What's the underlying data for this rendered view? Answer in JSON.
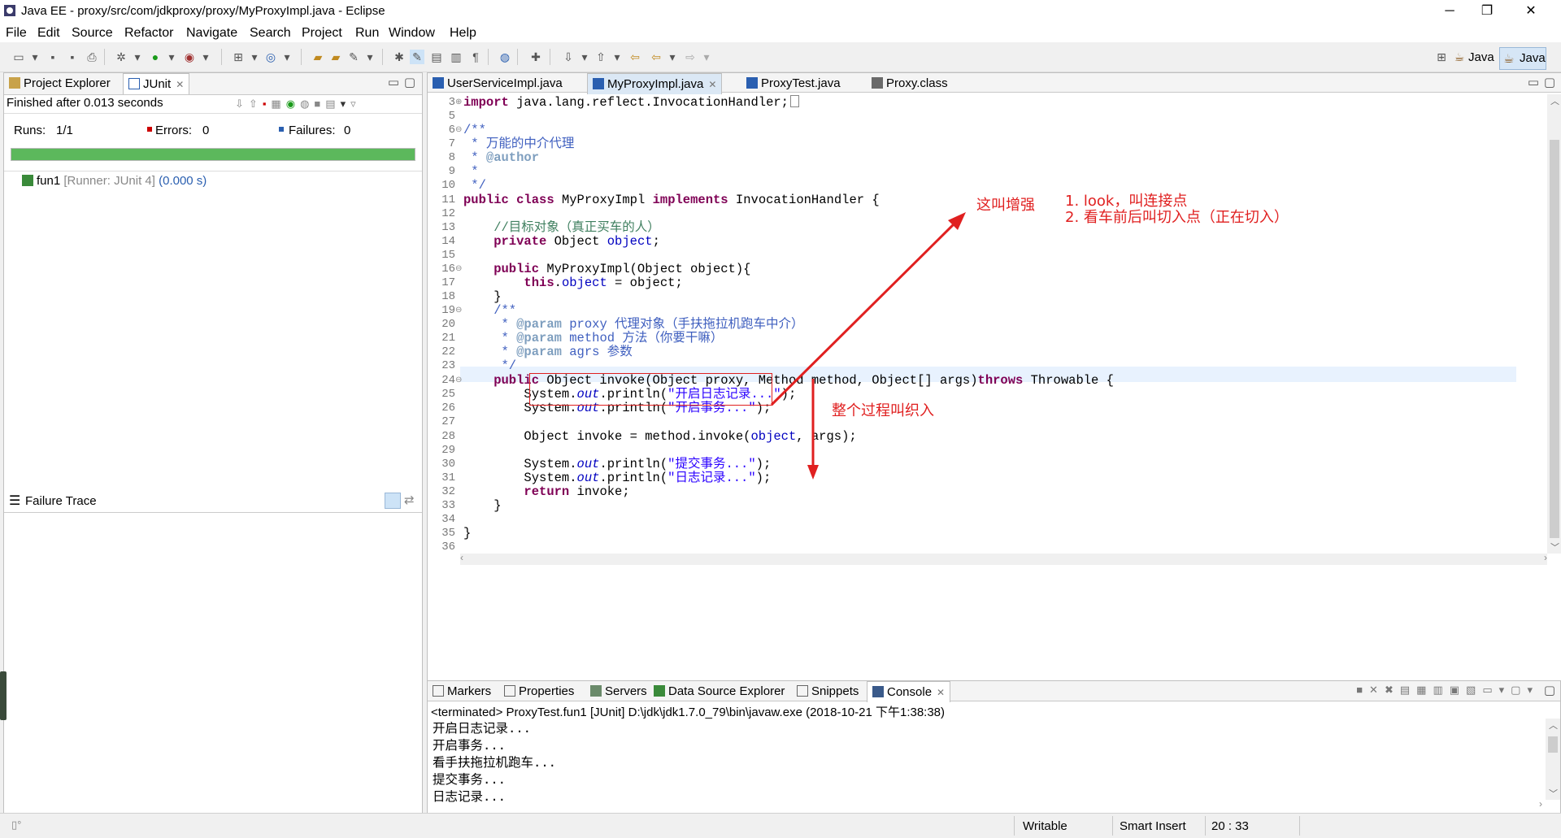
{
  "window": {
    "title": "Java EE - proxy/src/com/jdkproxy/proxy/MyProxyImpl.java - Eclipse"
  },
  "menu": [
    "File",
    "Edit",
    "Source",
    "Refactor",
    "Navigate",
    "Search",
    "Project",
    "Run",
    "Window",
    "Help"
  ],
  "perspectives": [
    "Java",
    "Java"
  ],
  "left_panel": {
    "tabs": [
      "Project Explorer",
      "JUnit"
    ],
    "status": "Finished after 0.013 seconds",
    "runs_label": "Runs:",
    "runs_value": "1/1",
    "errors_label": "Errors:",
    "errors_value": "0",
    "failures_label": "Failures:",
    "failures_value": "0",
    "progress": 1.0,
    "progress_color": "#5cb85c",
    "test_name": "fun1",
    "test_runner": "[Runner: JUnit 4]",
    "test_time": "(0.000 s)",
    "failure_trace": "Failure Trace"
  },
  "editor": {
    "tabs": [
      "UserServiceImpl.java",
      "MyProxyImpl.java",
      "ProxyTest.java",
      "Proxy.class"
    ],
    "active_tab": 1,
    "line_numbers": [
      "3",
      "5",
      "6",
      "7",
      "8",
      "9",
      "10",
      "11",
      "12",
      "13",
      "14",
      "15",
      "16",
      "17",
      "18",
      "19",
      "20",
      "21",
      "22",
      "23",
      "24",
      "25",
      "26",
      "27",
      "28",
      "29",
      "30",
      "31",
      "32",
      "33",
      "34",
      "35",
      "36"
    ],
    "lines": {
      "l3_kw": "import",
      "l3_rest": " java.lang.reflect.InvocationHandler;",
      "l6": "/**",
      "l7": " * 万能的中介代理",
      "l8_star": " * ",
      "l8_tag": "@author",
      "l9": " *",
      "l10": " */",
      "l11_kw1": "public",
      "l11_kw2": "class",
      "l11_name": "MyProxyImpl",
      "l11_kw3": "implements",
      "l11_rest": "InvocationHandler {",
      "l13": "    //目标对象（真正买车的人）",
      "l14_kw": "    private",
      "l14_type": " Object ",
      "l14_fld": "object",
      "l14_end": ";",
      "l16_kw": "    public",
      "l16_rest": " MyProxyImpl(Object object){",
      "l17_kw": "        this",
      "l17_dot": ".",
      "l17_fld": "object",
      "l17_rest": " = object;",
      "l18": "    }",
      "l19": "    /**",
      "l20_a": "     * ",
      "l20_tag": "@param",
      "l20_var": " proxy",
      "l20_txt": " 代理对象（手扶拖拉机跑车中介）",
      "l21_a": "     * ",
      "l21_tag": "@param",
      "l21_var": " method",
      "l21_txt": " 方法（你要干嘛）",
      "l22_a": "     * ",
      "l22_tag": "@param",
      "l22_var": " agrs",
      "l22_txt": " 参数",
      "l23": "     */",
      "l24_kw": "    public",
      "l24_rest": " Object invoke(Object proxy, Method method, Object[] args)",
      "l24_kw2": "throws",
      "l24_end": " Throwable {",
      "l25_a": "        System.",
      "l25_out": "out",
      "l25_b": ".println(",
      "l25_str": "\"开启日志记录...\"",
      "l25_c": ");",
      "l26_a": "        System.",
      "l26_out": "out",
      "l26_b": ".println(",
      "l26_str": "\"开启事务...\"",
      "l26_c": ");",
      "l28_a": "        Object invoke = method.invoke(",
      "l28_fld": "object",
      "l28_b": ", args);",
      "l30_a": "        System.",
      "l30_out": "out",
      "l30_b": ".println(",
      "l30_str": "\"提交事务...\"",
      "l30_c": ");",
      "l31_a": "        System.",
      "l31_out": "out",
      "l31_b": ".println(",
      "l31_str": "\"日志记录...\"",
      "l31_c": ");",
      "l32_kw": "        return",
      "l32_rest": " invoke;",
      "l33": "    }",
      "l35": "}"
    },
    "annotations": {
      "enhance": "这叫增强",
      "joinpoint_1": "1. look，叫连接点",
      "joinpoint_2": "2. 看车前后叫切入点（正在切入）",
      "weave": "整个过程叫织入"
    }
  },
  "bottom_panel": {
    "tabs": [
      "Markers",
      "Properties",
      "Servers",
      "Data Source Explorer",
      "Snippets",
      "Console"
    ],
    "console_header": "<terminated> ProxyTest.fun1 [JUnit] D:\\jdk\\jdk1.7.0_79\\bin\\javaw.exe (2018-10-21 下午1:38:38)",
    "console_lines": [
      "开启日志记录...",
      "开启事务...",
      "看手扶拖拉机跑车...",
      "提交事务...",
      "日志记录..."
    ]
  },
  "status_bar": {
    "writable": "Writable",
    "insert_mode": "Smart Insert",
    "position": "20 : 33"
  }
}
